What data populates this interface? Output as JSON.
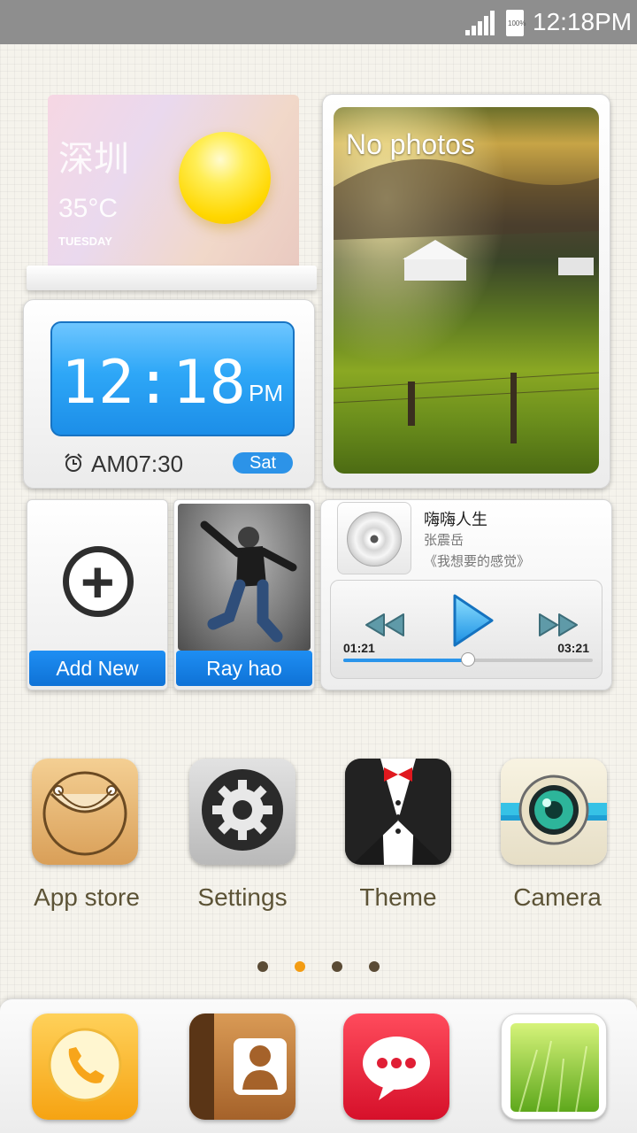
{
  "status_bar": {
    "time": "12:18PM",
    "battery_label": "100%"
  },
  "weather": {
    "city": "深圳",
    "temperature": "35°C",
    "day": "TUESDAY"
  },
  "clock": {
    "time": "12:18",
    "ampm": "PM",
    "alarm": "AM07:30",
    "day": "Sat"
  },
  "photo": {
    "text": "No photos"
  },
  "tiles": [
    {
      "label": "Add New"
    },
    {
      "label": "Ray hao"
    }
  ],
  "music": {
    "title": "嗨嗨人生",
    "artist": "张震岳",
    "album": "《我想要的感觉》",
    "elapsed": "01:21",
    "duration": "03:21",
    "progress": 0.5
  },
  "apps": [
    {
      "label": "App store",
      "icon": "shopping-bag-icon"
    },
    {
      "label": "Settings",
      "icon": "gear-icon"
    },
    {
      "label": "Theme",
      "icon": "tuxedo-icon"
    },
    {
      "label": "Camera",
      "icon": "camera-icon"
    }
  ],
  "pager": {
    "pages": 4,
    "active": 1,
    "active_color": "#f39c12"
  },
  "dock": [
    {
      "icon": "phone-icon"
    },
    {
      "icon": "contacts-icon"
    },
    {
      "icon": "messages-icon"
    },
    {
      "icon": "gallery-icon"
    }
  ]
}
